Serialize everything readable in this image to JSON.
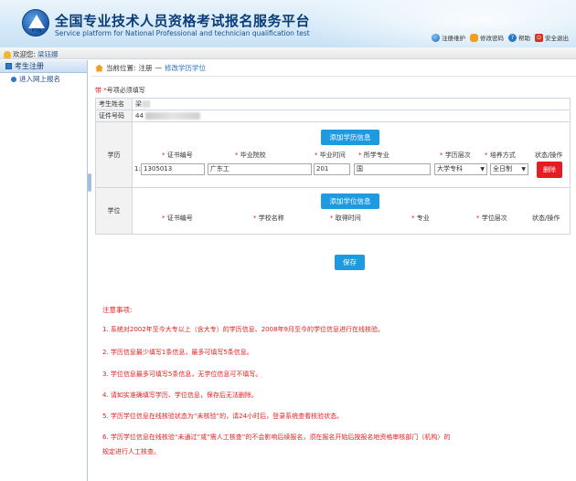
{
  "header": {
    "logo_text": "PTA",
    "title_cn": "全国专业技术人员资格考试报名服务平台",
    "title_en": "Service platform for National Professional and technician qualification test",
    "nav": [
      {
        "label": "注册维护",
        "icon": "globe-icon"
      },
      {
        "label": "修改密码",
        "icon": "user-key-icon"
      },
      {
        "label": "帮助",
        "icon": "help-icon"
      },
      {
        "label": "安全退出",
        "icon": "exit-icon"
      }
    ]
  },
  "welcome": {
    "prefix": "欢迎您:",
    "name": "梁钰娜"
  },
  "sidebar": {
    "section": "考生注册",
    "items": [
      {
        "label": "进入网上报名"
      }
    ]
  },
  "breadcrumb": {
    "prefix": "当前位置:",
    "current": "注册",
    "sep": "—",
    "link": "修改学历学位"
  },
  "form": {
    "required_note_star": "带 *",
    "required_note": "号项必须填写",
    "name_label": "考生姓名",
    "name_value": "梁",
    "id_label": "证件号码",
    "id_value": "44",
    "education": {
      "label": "学历",
      "add_button": "添加学历信息",
      "columns": [
        "证书编号",
        "毕业院校",
        "毕业时间",
        "所学专业",
        "学历层次",
        "培养方式",
        "状态/操作"
      ],
      "rows": [
        {
          "index": "1:",
          "cert_no": "1305013",
          "school": "广东工",
          "grad_time": "201",
          "major": "国",
          "level": "大学专科",
          "mode": "全日制",
          "action": "删除"
        }
      ]
    },
    "degree": {
      "label": "学位",
      "add_button": "添加学位信息",
      "columns": [
        "证书编号",
        "学校名称",
        "取得时间",
        "专业",
        "学位层次",
        "状态/操作"
      ]
    },
    "save_button": "保存"
  },
  "notices": {
    "title": "注意事项:",
    "items": [
      "1. 系统对2002年至今大专以上（含大专）的学历信息、2008年9月至今的学位信息进行在线核验。",
      "2. 学历信息最少填写1条信息，最多可填写5条信息。",
      "3. 学位信息最多可填写5条信息，无学位信息可不填写。",
      "4. 请如实准确填写学历、学位信息，保存后无法删除。",
      "5. 学历学位信息在线核验状态为“未核验”的，请24小时后，登录系统查看核验状态。",
      "6. 学历学位信息在线核验“未通过”或“需人工核查”的不会影响后续报名，须在报名开始后按报名地资格审核部门（机构）的",
      "规定进行人工核查。"
    ]
  },
  "colors": {
    "accent": "#1e9be0",
    "danger": "#e51c23",
    "notice": "#e02020",
    "title": "#0b3c7a"
  }
}
